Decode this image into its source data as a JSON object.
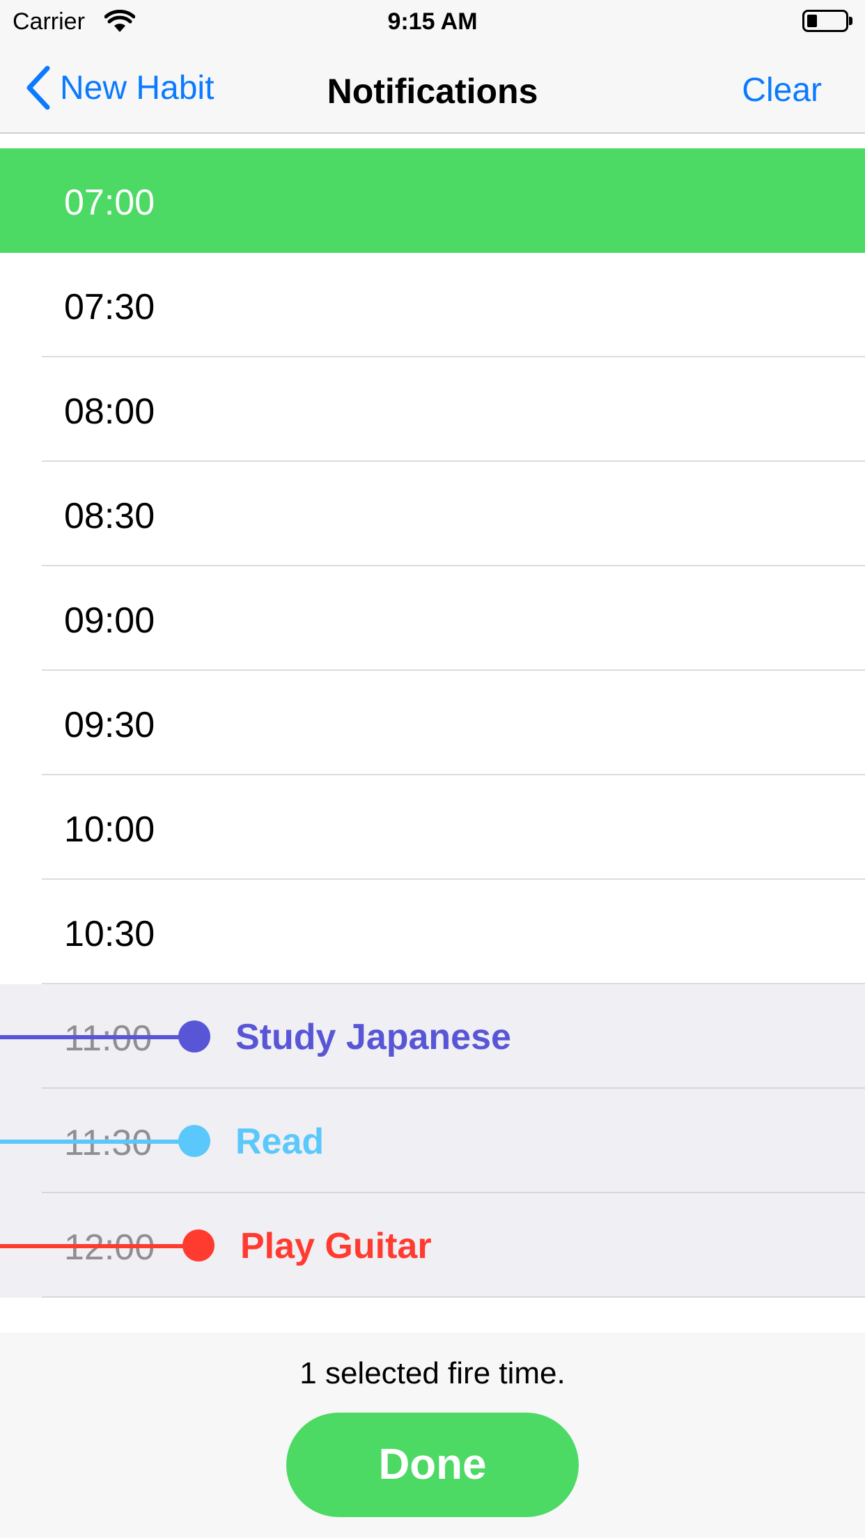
{
  "status_bar": {
    "carrier": "Carrier",
    "time": "9:15 AM"
  },
  "nav": {
    "back_label": "New Habit",
    "title": "Notifications",
    "clear_label": "Clear"
  },
  "colors": {
    "accent": "#0a7aff",
    "selected": "#4cd964",
    "taken_bg": "#efeff4",
    "study_japanese": "#5856d6",
    "read": "#5ac8fa",
    "play_guitar": "#ff3b30"
  },
  "times": [
    {
      "label": "07:00",
      "state": "selected"
    },
    {
      "label": "07:30",
      "state": "available"
    },
    {
      "label": "08:00",
      "state": "available"
    },
    {
      "label": "08:30",
      "state": "available"
    },
    {
      "label": "09:00",
      "state": "available"
    },
    {
      "label": "09:30",
      "state": "available"
    },
    {
      "label": "10:00",
      "state": "available"
    },
    {
      "label": "10:30",
      "state": "available"
    },
    {
      "label": "11:00",
      "state": "taken",
      "habit": "Study Japanese",
      "color": "#5856d6"
    },
    {
      "label": "11:30",
      "state": "taken",
      "habit": "Read",
      "color": "#5ac8fa"
    },
    {
      "label": "12:00",
      "state": "taken",
      "habit": "Play Guitar",
      "color": "#ff3b30"
    }
  ],
  "footer": {
    "summary": "1 selected fire time.",
    "done_label": "Done"
  }
}
